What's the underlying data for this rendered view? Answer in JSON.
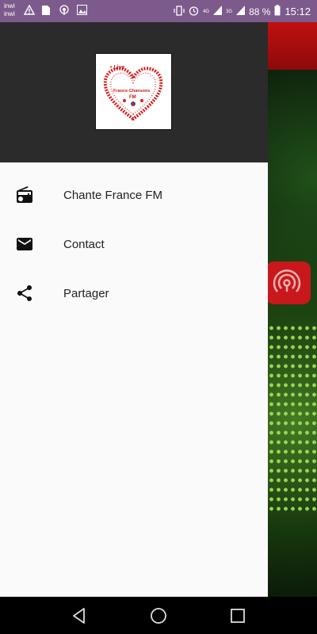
{
  "status_bar": {
    "carrier_top": "inwi",
    "carrier_bottom": "inwi",
    "network_top": "4G",
    "network_bottom": "3G",
    "battery": "88 %",
    "time": "15:12",
    "icons": [
      "warning-icon",
      "sim-icon",
      "hotspot-icon",
      "image-icon",
      "vibrate-icon",
      "alarm-icon",
      "signal-icon",
      "battery-icon"
    ]
  },
  "drawer": {
    "logo": {
      "live": "• Live",
      "name": "France-Chansons",
      "fm": "FM"
    },
    "menu": [
      {
        "label": "Chante France FM",
        "icon": "radio-icon"
      },
      {
        "label": "Contact",
        "icon": "mail-icon"
      },
      {
        "label": "Partager",
        "icon": "share-icon"
      }
    ]
  },
  "nav_bar": {
    "buttons": [
      "back-icon",
      "home-icon",
      "recents-icon"
    ]
  },
  "colors": {
    "status_bar": "#7d5a8c",
    "drawer_header": "#2b2b2b",
    "drawer_bg": "#fafafa",
    "accent_red": "#c8181c"
  }
}
